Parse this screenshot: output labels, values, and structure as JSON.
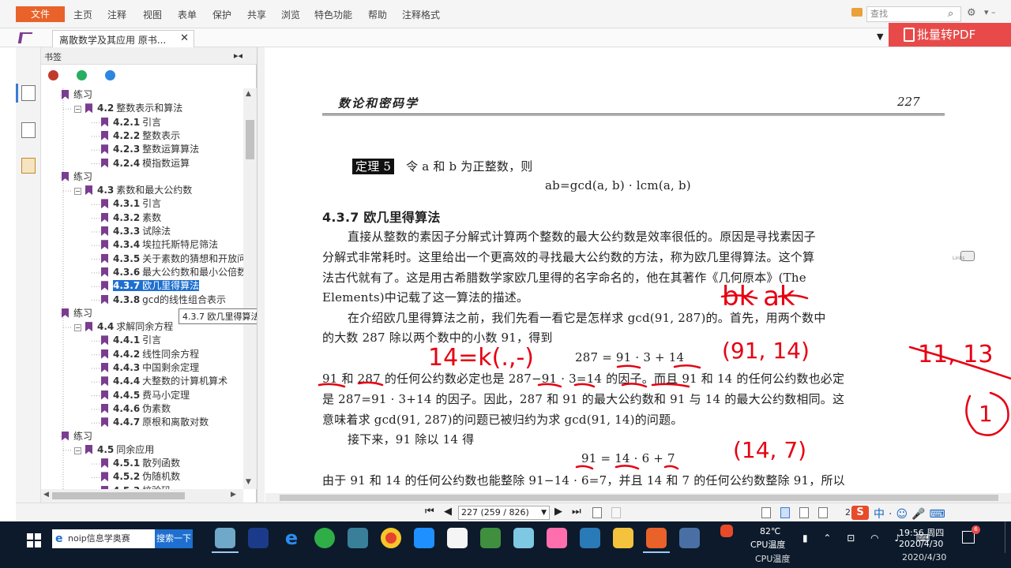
{
  "menu": {
    "file": "文件",
    "items": [
      "主页",
      "注释",
      "视图",
      "表单",
      "保护",
      "共享",
      "浏览",
      "特色功能",
      "帮助",
      "注释格式"
    ],
    "search_placeholder": "查找"
  },
  "tab": {
    "title": "离散数学及其应用 原书...",
    "close": "✕",
    "dropdown": "▼"
  },
  "batch_pdf": "批量转PDF",
  "bookmarks": {
    "title": "书签",
    "collapse": "▸◂",
    "tooltip": "4.3.7 欧几里得算法",
    "rows": [
      {
        "level": 1,
        "label": "练习"
      },
      {
        "level": 1,
        "num": "4.2",
        "label": "整数表示和算法",
        "toggle": "−"
      },
      {
        "level": 2,
        "num": "4.2.1",
        "label": "引言"
      },
      {
        "level": 2,
        "num": "4.2.2",
        "label": "整数表示"
      },
      {
        "level": 2,
        "num": "4.2.3",
        "label": "整数运算算法"
      },
      {
        "level": 2,
        "num": "4.2.4",
        "label": "模指数运算"
      },
      {
        "level": 1,
        "label": "练习"
      },
      {
        "level": 1,
        "num": "4.3",
        "label": "素数和最大公约数",
        "toggle": "−"
      },
      {
        "level": 2,
        "num": "4.3.1",
        "label": "引言"
      },
      {
        "level": 2,
        "num": "4.3.2",
        "label": "素数"
      },
      {
        "level": 2,
        "num": "4.3.3",
        "label": "试除法"
      },
      {
        "level": 2,
        "num": "4.3.4",
        "label": "埃拉托斯特尼筛法"
      },
      {
        "level": 2,
        "num": "4.3.5",
        "label": "关于素数的猜想和开放问"
      },
      {
        "level": 2,
        "num": "4.3.6",
        "label": "最大公约数和最小公倍数"
      },
      {
        "level": 2,
        "num": "4.3.7",
        "label": "欧几里得算法",
        "selected": true
      },
      {
        "level": 2,
        "num": "4.3.8",
        "label": "gcd的线性组合表示"
      },
      {
        "level": 1,
        "label": "练习"
      },
      {
        "level": 1,
        "num": "4.4",
        "label": "求解同余方程",
        "toggle": "−"
      },
      {
        "level": 2,
        "num": "4.4.1",
        "label": "引言"
      },
      {
        "level": 2,
        "num": "4.4.2",
        "label": "线性同余方程"
      },
      {
        "level": 2,
        "num": "4.4.3",
        "label": "中国剩余定理"
      },
      {
        "level": 2,
        "num": "4.4.4",
        "label": "大整数的计算机算术"
      },
      {
        "level": 2,
        "num": "4.4.5",
        "label": "费马小定理"
      },
      {
        "level": 2,
        "num": "4.4.6",
        "label": "伪素数"
      },
      {
        "level": 2,
        "num": "4.4.7",
        "label": "原根和离散对数"
      },
      {
        "level": 1,
        "label": "练习"
      },
      {
        "level": 1,
        "num": "4.5",
        "label": "同余应用",
        "toggle": "−"
      },
      {
        "level": 2,
        "num": "4.5.1",
        "label": "散列函数"
      },
      {
        "level": 2,
        "num": "4.5.2",
        "label": "伪随机数"
      },
      {
        "level": 2,
        "num": "4.5.3",
        "label": "校验码"
      }
    ]
  },
  "page": {
    "header_title": "数论和密码学",
    "page_number": "227",
    "theorem_label": "定理 5",
    "theorem_text": "令 a 和 b 为正整数，则",
    "theorem_formula": "ab=gcd(a, b) · lcm(a, b)",
    "section_title": "4.3.7  欧几里得算法",
    "lines": [
      "直接从整数的素因子分解式计算两个整数的最大公约数是效率很低的。原因是寻找素因子",
      "分解式非常耗时。这里给出一个更高效的寻找最大公约数的方法，称为欧几里得算法。这个算",
      "法古代就有了。这是用古希腊数学家欧几里得的名字命名的，他在其著作《几何原本》(The",
      "Elements)中记载了这一算法的描述。",
      "在介绍欧几里得算法之前，我们先看一看它是怎样求 gcd(91, 287)的。首先，用两个数中",
      "的大数 287 除以两个数中的小数 91，得到",
      "287 = 91 · 3 + 14",
      "91 和 287 的任何公约数必定也是 287−91 · 3=14 的因子。而且 91 和 14 的任何公约数也必定",
      "是 287=91 · 3+14 的因子。因此，287 和 91 的最大公约数和 91 与 14 的最大公约数相同。这",
      "意味着求 gcd(91, 287)的问题已被归约为求 gcd(91, 14)的问题。",
      "接下来，91 除以 14 得",
      "91 = 14 · 6 + 7",
      "由于 91 和 14 的任何公约数也能整除 91−14 · 6=7，并且 14 和 7 的任何公约数整除 91，所以"
    ],
    "side_note": "Links"
  },
  "handwriting": {
    "bk_ak": "bk  ak",
    "pair_91_14": "(91, 14)",
    "eq_14k": "14=k(.,-)",
    "pair_11_13": "11, 13",
    "circled": "1",
    "pair_14_7": "(14, 7)"
  },
  "status": {
    "page_field": "227 (259 / 826)",
    "first": "⏮",
    "prev": "◀",
    "next": "▶",
    "last": "⏭",
    "zoom_hint": "2",
    "ime": "中·☺🎤⌨"
  },
  "taskbar": {
    "search_text": "noip信息学奥赛",
    "search_button": "搜索一下",
    "temp_value": "82℃",
    "temp_label": "CPU温度",
    "time": "19:56 周四",
    "date": "2020/4/30",
    "notify_count": "6"
  },
  "colors": {
    "accent": "#e8622a",
    "ink": "#e60012",
    "selection": "#1e6fcf",
    "bookmark_flag": "#7a3d8f"
  }
}
